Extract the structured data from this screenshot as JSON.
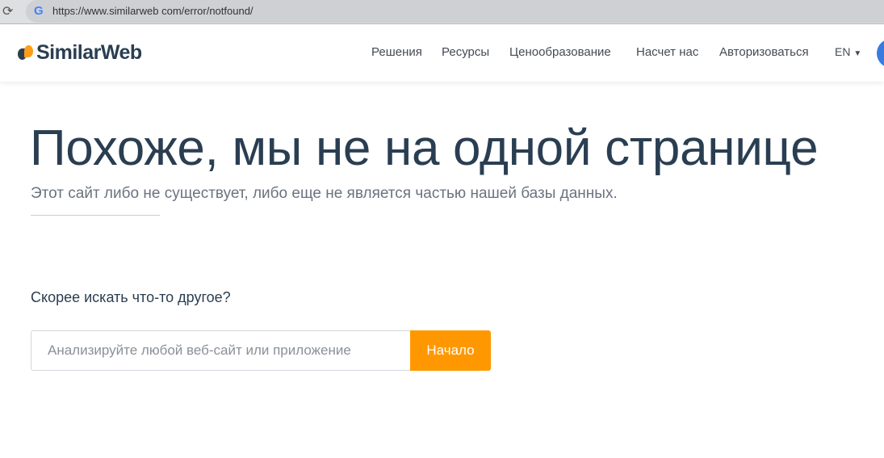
{
  "browser": {
    "url": "https://www.similarweb com/error/notfound/"
  },
  "header": {
    "logo": "SimilarWeb",
    "nav": [
      "Решения",
      "Ресурсы",
      "Ценообразование",
      "Насчет нас",
      "Авторизоваться"
    ],
    "lang": "EN"
  },
  "main": {
    "title": "Похоже, мы не на одной странице",
    "subtitle": "Этот сайт либо не существует, либо еще не является частью нашей базы данных.",
    "prompt": "Скорее искать что-то другое?",
    "search_placeholder": "Анализируйте любой веб-сайт или приложение",
    "search_button": "Начало"
  },
  "colors": {
    "accent": "#ff9800",
    "text": "#2a3e52"
  }
}
